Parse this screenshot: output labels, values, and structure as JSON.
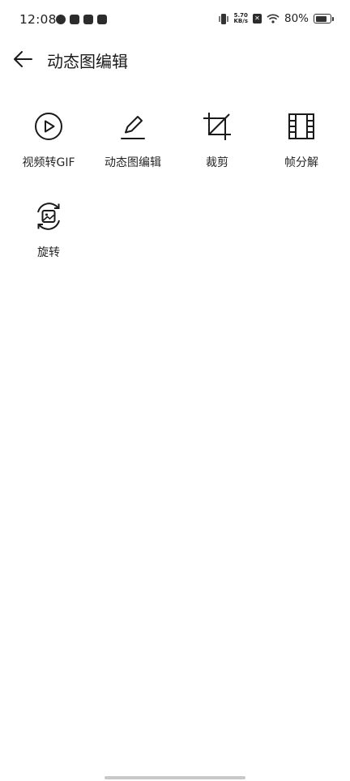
{
  "status_bar": {
    "time": "12:08",
    "speed_value": "5.70",
    "speed_unit": "KB/s",
    "battery_percent": "80%",
    "battery_level": 0.8
  },
  "header": {
    "title": "动态图编辑",
    "back_icon": "arrow-left-icon"
  },
  "tools": [
    {
      "label": "视频转GIF",
      "icon": "play-circle-icon"
    },
    {
      "label": "动态图编辑",
      "icon": "pen-icon"
    },
    {
      "label": "裁剪",
      "icon": "crop-icon"
    },
    {
      "label": "帧分解",
      "icon": "frame-grid-icon"
    },
    {
      "label": "旋转",
      "icon": "rotate-image-icon"
    }
  ]
}
